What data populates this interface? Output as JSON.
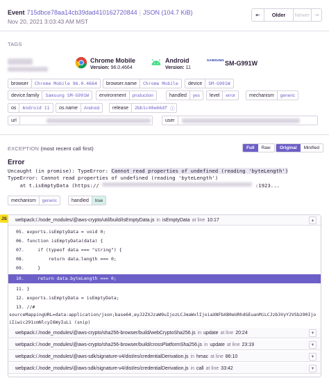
{
  "header": {
    "event_label": "Event",
    "event_id": "715dbce78aa14cb39dad410162720844",
    "json_link": "JSON (104.7 KiB)",
    "timestamp": "Nov 20, 2021 3:03:43 AM MST",
    "nav": {
      "first": "⇤",
      "older": "Older",
      "newer": "Newer",
      "last": "⇥"
    }
  },
  "tags": {
    "title": "TAGS",
    "contexts": [
      {
        "name": "Chrome Mobile",
        "version_label": "Version:",
        "version": "96.0.4664"
      },
      {
        "name": "Android",
        "version_label": "Version:",
        "version": "11"
      },
      {
        "brand": "SAMSUNG",
        "name": "SM-G991W"
      }
    ],
    "rows": [
      [
        {
          "k": "browser",
          "v": "Chrome Mobile 96.0.4664"
        },
        {
          "k": "browser.name",
          "v": "Chrome Mobile"
        },
        {
          "k": "device",
          "v": "SM-G991W"
        }
      ],
      [
        {
          "k": "device.family",
          "v": "Samsung SM-G991W"
        },
        {
          "k": "environment",
          "v": "production"
        },
        {
          "k": "handled",
          "v": "yes"
        },
        {
          "k": "level",
          "v": "error"
        },
        {
          "k": "mechanism",
          "v": "generic"
        }
      ],
      [
        {
          "k": "os",
          "v": "Android 11"
        },
        {
          "k": "os.name",
          "v": "Android"
        },
        {
          "k": "release",
          "v": "2bb1c40e66df"
        }
      ],
      [
        {
          "k": "url",
          "v": ""
        },
        {
          "k": "user",
          "v": ""
        }
      ]
    ]
  },
  "exception": {
    "title": "EXCEPTION",
    "subtitle": "(most recent call first)",
    "toggle1": [
      "Full",
      "Raw"
    ],
    "toggle2": [
      "Original",
      "Minified"
    ],
    "error_title": "Error",
    "trace_line1_prefix": "Uncaught (in promise): TypeError: ",
    "trace_line1_highlight": "Cannot read properties of undefined (reading 'byteLength')",
    "trace_line2": "TypeError: Cannot read properties of undefined (reading 'byteLength')",
    "trace_line3_prefix": "    at t.isEmptyData (https://",
    "trace_line3_suffix": ":1923...",
    "mechanism": [
      {
        "k": "mechanism",
        "v": "generic"
      },
      {
        "k": "handled",
        "v": "true"
      }
    ]
  },
  "frames": {
    "badge": "JS",
    "main": {
      "path": "webpack:/./node_modules/@aws-crypto/util/build/isEmptyData.js",
      "in": "in",
      "fn": "isEmptyData",
      "at": "at line",
      "line": "10:17"
    },
    "code": [
      "05. exports.isEmptyData = void 0;",
      "06. function isEmptyData(data) {",
      "07.     if (typeof data === \"string\") {",
      "08.         return data.length === 0;",
      "09.     }",
      "10.     return data.byteLength === 0;",
      "11. }",
      "12. exports.isEmptyData = isEmptyData;",
      "13. //#",
      "sourceMappingURL=data:application/json;base64,eyJ2ZXJzaW9uIjozLCJmaWxlIjoiaXNFbXB0eURhdGEuanMiLCJzb3VyY2VSb290IjoiIiwic291cmNlcyI6WyIuLi (snip)"
    ],
    "others": [
      {
        "path": "webpack:/./node_modules/@aws-crypto/sha256-browser/build/webCryptoSha256.js",
        "in": "in",
        "fn": "update",
        "at": "at line",
        "line": "20:24"
      },
      {
        "path": "webpack:/./node_modules/@aws-crypto/sha256-browser/build/crossPlatformSha256.js",
        "in": "in",
        "fn": "update",
        "at": "at line",
        "line": "23:19"
      },
      {
        "path": "webpack:/./node_modules/@aws-sdk/signature-v4/dist/es/credentialDerivation.js",
        "in": "in",
        "fn": "hmac",
        "at": "at line",
        "line": "86:10"
      },
      {
        "path": "webpack:/./node_modules/@aws-sdk/signature-v4/dist/es/credentialDerivation.js",
        "in": "in",
        "fn": "call",
        "at": "at line",
        "line": "33:42"
      }
    ]
  }
}
